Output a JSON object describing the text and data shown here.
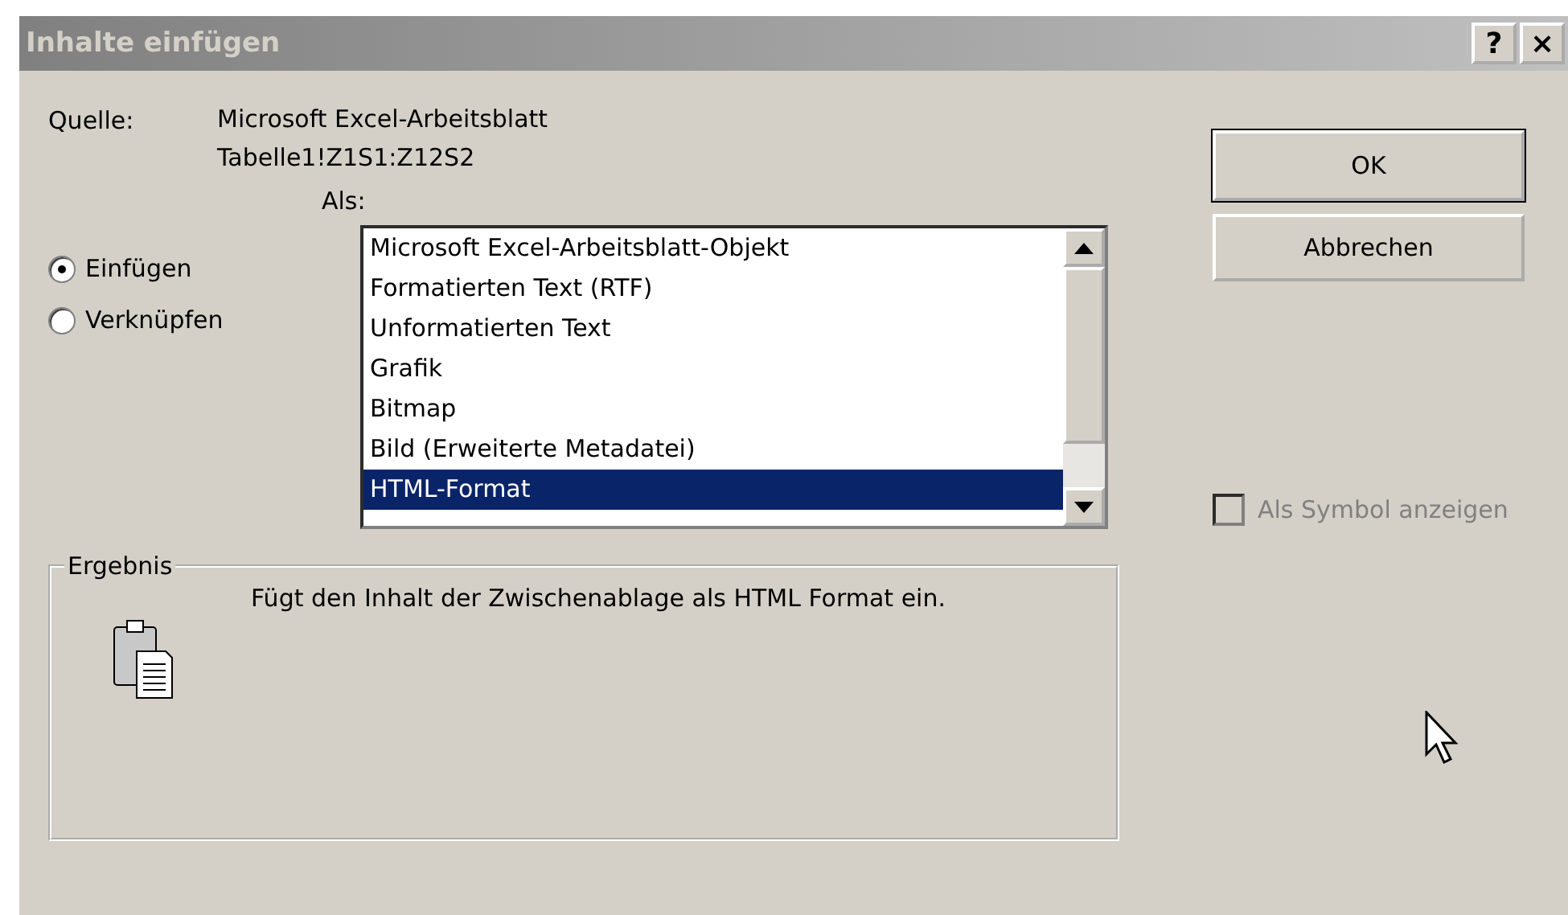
{
  "window": {
    "title": "Inhalte einfügen",
    "title_buttons": [
      "?",
      "×"
    ]
  },
  "source": {
    "label": "Quelle:",
    "lines": [
      "Microsoft Excel-Arbeitsblatt",
      "Tabelle1!Z1S1:Z12S2"
    ]
  },
  "as_label": "Als:",
  "options": [
    {
      "label": "Einfügen",
      "selected": true
    },
    {
      "label": "Verknüpfen",
      "selected": false
    }
  ],
  "formats": [
    {
      "label": "Microsoft Excel-Arbeitsblatt-Objekt",
      "selected": false
    },
    {
      "label": "Formatierten Text (RTF)",
      "selected": false
    },
    {
      "label": "Unformatierten Text",
      "selected": false
    },
    {
      "label": "Grafik",
      "selected": false
    },
    {
      "label": "Bitmap",
      "selected": false
    },
    {
      "label": "Bild (Erweiterte Metadatei)",
      "selected": false
    },
    {
      "label": "HTML-Format",
      "selected": true
    }
  ],
  "buttons": [
    "OK",
    "Abbrechen"
  ],
  "show_as_icon": {
    "label": "Als Symbol anzeigen",
    "checked": false,
    "disabled": true
  },
  "result": {
    "title": "Ergebnis",
    "text": "Fügt den Inhalt der Zwischenablage als HTML Format ein."
  }
}
